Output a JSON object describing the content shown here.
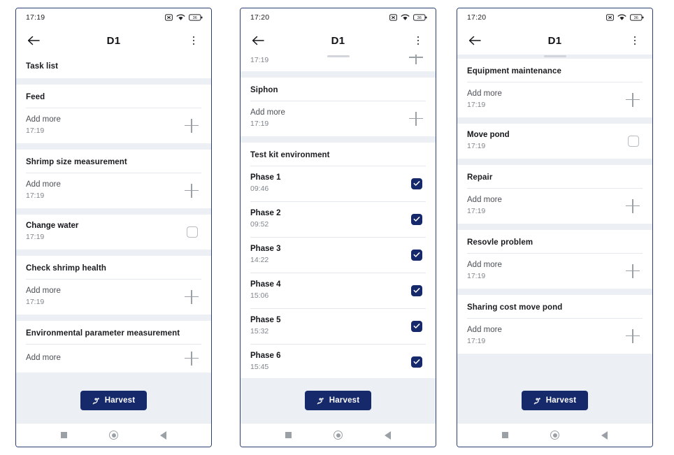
{
  "page": {
    "background": "#ffffff",
    "accent": "#16296a"
  },
  "statusbar": {
    "time_1": "17:19",
    "time_2": "17:20",
    "time_3": "17:20",
    "battery_level": "36",
    "icons": [
      "alarm-off-icon",
      "wifi-icon",
      "battery-icon"
    ]
  },
  "appbar": {
    "title": "D1",
    "back_icon": "back-arrow-icon",
    "menu_icon": "overflow-menu-icon"
  },
  "footer": {
    "harvest_label": "Harvest",
    "harvest_icon": "shrimp-icon"
  },
  "navbar": {
    "recents": "recents-square",
    "home": "home-circle",
    "back": "back-triangle"
  },
  "common": {
    "add_more": "Add more",
    "default_time": "17:19",
    "plus_icon": "plus-icon",
    "checkbox_icon": "checkbox-icon"
  },
  "screen1": {
    "list_header": "Task list",
    "cards": [
      {
        "title": "Feed",
        "label": "Add more",
        "time": "17:19",
        "control": "plus"
      },
      {
        "title": "Shrimp size measurement",
        "label": "Add more",
        "time": "17:19",
        "control": "plus"
      },
      {
        "title": "Change water",
        "time": "17:19",
        "control": "checkbox",
        "checked": false
      },
      {
        "title": "Check shrimp health",
        "label": "Add more",
        "time": "17:19",
        "control": "plus"
      },
      {
        "title": "Environmental parameter measurement",
        "label": "Add more",
        "time": "",
        "control": "plus",
        "clipped": true
      }
    ]
  },
  "screen2": {
    "clipped_top": {
      "time": "17:19",
      "control": "plus"
    },
    "cards": [
      {
        "title": "Siphon",
        "label": "Add more",
        "time": "17:19",
        "control": "plus"
      }
    ],
    "test_kit": {
      "title": "Test kit environment",
      "phases": [
        {
          "label": "Phase 1",
          "time": "09:46",
          "checked": true
        },
        {
          "label": "Phase 2",
          "time": "09:52",
          "checked": true
        },
        {
          "label": "Phase 3",
          "time": "14:22",
          "checked": true
        },
        {
          "label": "Phase 4",
          "time": "15:06",
          "checked": true
        },
        {
          "label": "Phase 5",
          "time": "15:32",
          "checked": true
        },
        {
          "label": "Phase 6",
          "time": "15:45",
          "checked": true
        }
      ]
    }
  },
  "screen3": {
    "cards": [
      {
        "title": "Equipment maintenance",
        "label": "Add more",
        "time": "17:19",
        "control": "plus"
      },
      {
        "title": "Move pond",
        "time": "17:19",
        "control": "checkbox",
        "checked": false
      },
      {
        "title": "Repair",
        "label": "Add more",
        "time": "17:19",
        "control": "plus"
      },
      {
        "title": "Resovle problem",
        "label": "Add more",
        "time": "17:19",
        "control": "plus"
      },
      {
        "title": "Sharing cost move pond",
        "label": "Add more",
        "time": "17:19",
        "control": "plus"
      }
    ]
  }
}
